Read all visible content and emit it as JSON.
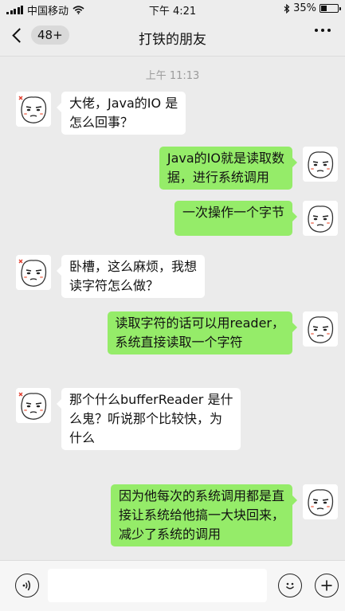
{
  "status_bar": {
    "carrier": "中国移动",
    "time": "下午 4:21",
    "battery_percent": "35%",
    "battery_level": 0.35,
    "icons": [
      "signal-icon",
      "wifi-icon",
      "bluetooth-icon",
      "battery-icon"
    ]
  },
  "nav": {
    "back_count": "48+",
    "title": "打铁的朋友",
    "more_icon": "more-icon"
  },
  "chat": {
    "timestamp": "上午 11:13",
    "messages": [
      {
        "side": "left",
        "text": "大佬，Java的IO 是\n怎么回事？"
      },
      {
        "side": "right",
        "text": "Java的IO就是读取数\n据，进行系统调用"
      },
      {
        "side": "right",
        "text": "一次操作一个字节"
      },
      {
        "side": "left",
        "text": "卧槽，这么麻烦，我想\n读字符怎么做？"
      },
      {
        "side": "right",
        "text": "读取字符的话可以用reader，\n系统直接读取一个字符"
      },
      {
        "side": "left",
        "text": "那个什么bufferReader 是什\n么鬼？听说那个比较快，为\n什么"
      },
      {
        "side": "right",
        "text": "因为他每次的系统调用都是直\n接让系统给他搞一大块回来，\n减少了系统的调用"
      }
    ]
  },
  "input_bar": {
    "icons": [
      "voice-icon",
      "emoji-icon",
      "plus-icon"
    ]
  },
  "colors": {
    "background": "#ebebeb",
    "bubble_sent": "#95ec69",
    "bubble_received": "#ffffff",
    "timestamp": "#9b9b9b"
  }
}
